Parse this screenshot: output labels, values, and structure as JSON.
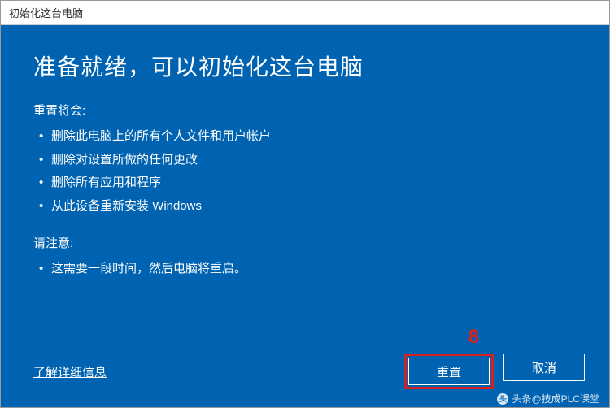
{
  "window": {
    "title": "初始化这台电脑"
  },
  "content": {
    "heading": "准备就绪，可以初始化这台电脑",
    "reset_label": "重置将会:",
    "reset_items": [
      "删除此电脑上的所有个人文件和用户帐户",
      "删除对设置所做的任何更改",
      "删除所有应用和程序",
      "从此设备重新安装 Windows"
    ],
    "note_label": "请注意:",
    "note_items": [
      "这需要一段时间，然后电脑将重启。"
    ]
  },
  "footer": {
    "learn_more": "了解详细信息",
    "reset_button": "重置",
    "cancel_button": "取消"
  },
  "annotation": {
    "number": "8"
  },
  "watermark": {
    "text": "头条@技成PLC课堂"
  }
}
